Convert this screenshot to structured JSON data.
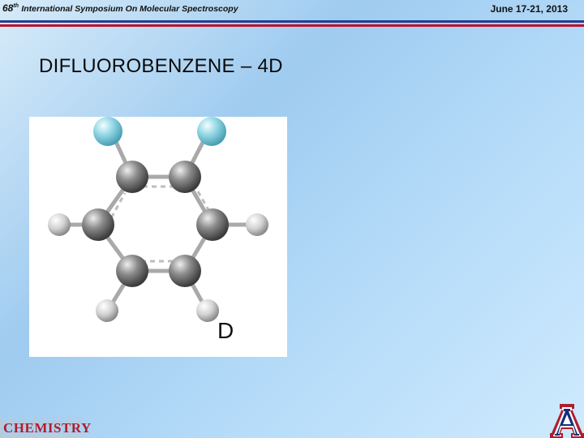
{
  "header": {
    "number": "68",
    "superscript": "th",
    "symposium": "International Symposium On Molecular Spectroscopy",
    "date": "June 17-21, 2013"
  },
  "slide": {
    "title": "DIFLUOROBENZENE – 4D",
    "molecule_label": "D"
  },
  "footer": {
    "department_logo_text": "CHEMISTRY"
  },
  "colors": {
    "rule_blue": "#233f8e",
    "rule_red": "#c0112b",
    "logo_red": "#b01d2d",
    "logo_navy": "#12307a"
  }
}
